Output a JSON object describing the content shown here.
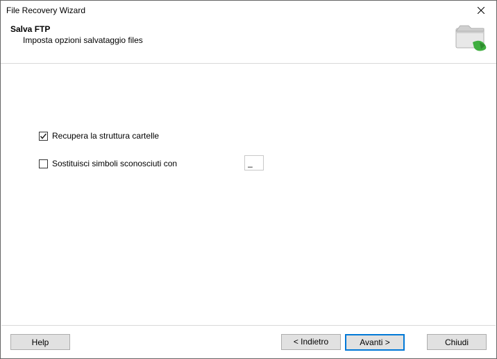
{
  "window": {
    "title": "File Recovery Wizard"
  },
  "header": {
    "heading": "Salva FTP",
    "subheading": "Imposta opzioni salvataggio files"
  },
  "options": {
    "recover_structure": {
      "label": "Recupera la struttura cartelle",
      "checked": true
    },
    "replace_symbols": {
      "label": "Sostituisci simboli sconosciuti con",
      "checked": false,
      "value": "_"
    }
  },
  "footer": {
    "help": "Help",
    "back": "< Indietro",
    "next": "Avanti >",
    "close": "Chiudi"
  }
}
